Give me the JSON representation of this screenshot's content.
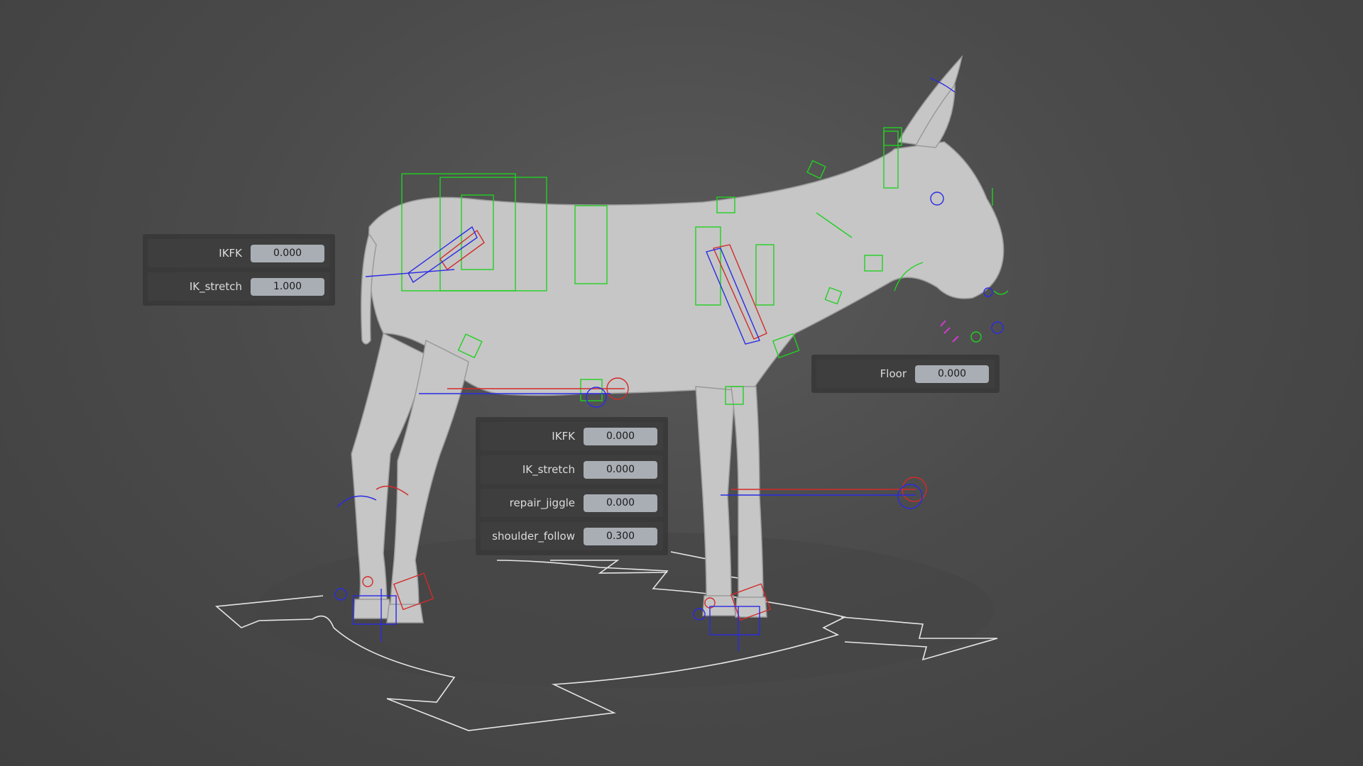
{
  "viewport": {
    "background_top": "#5a5a5a",
    "background_bottom": "#3f3f3f",
    "rig_colors": {
      "fk": "#22d022",
      "left_side": "#2a2ae6",
      "right_side": "#d42a2a",
      "root": "#e6e6e6",
      "mesh": "#c8c8c8"
    }
  },
  "panels": {
    "back_leg": {
      "rows": [
        {
          "label": "IKFK",
          "value": "0.000"
        },
        {
          "label": "IK_stretch",
          "value": "1.000"
        }
      ]
    },
    "front_leg": {
      "rows": [
        {
          "label": "IKFK",
          "value": "0.000"
        },
        {
          "label": "IK_stretch",
          "value": "0.000"
        },
        {
          "label": "repair_jiggle",
          "value": "0.000"
        },
        {
          "label": "shoulder_follow",
          "value": "0.300"
        }
      ]
    },
    "head": {
      "rows": [
        {
          "label": "Floor",
          "value": "0.000"
        }
      ]
    }
  }
}
